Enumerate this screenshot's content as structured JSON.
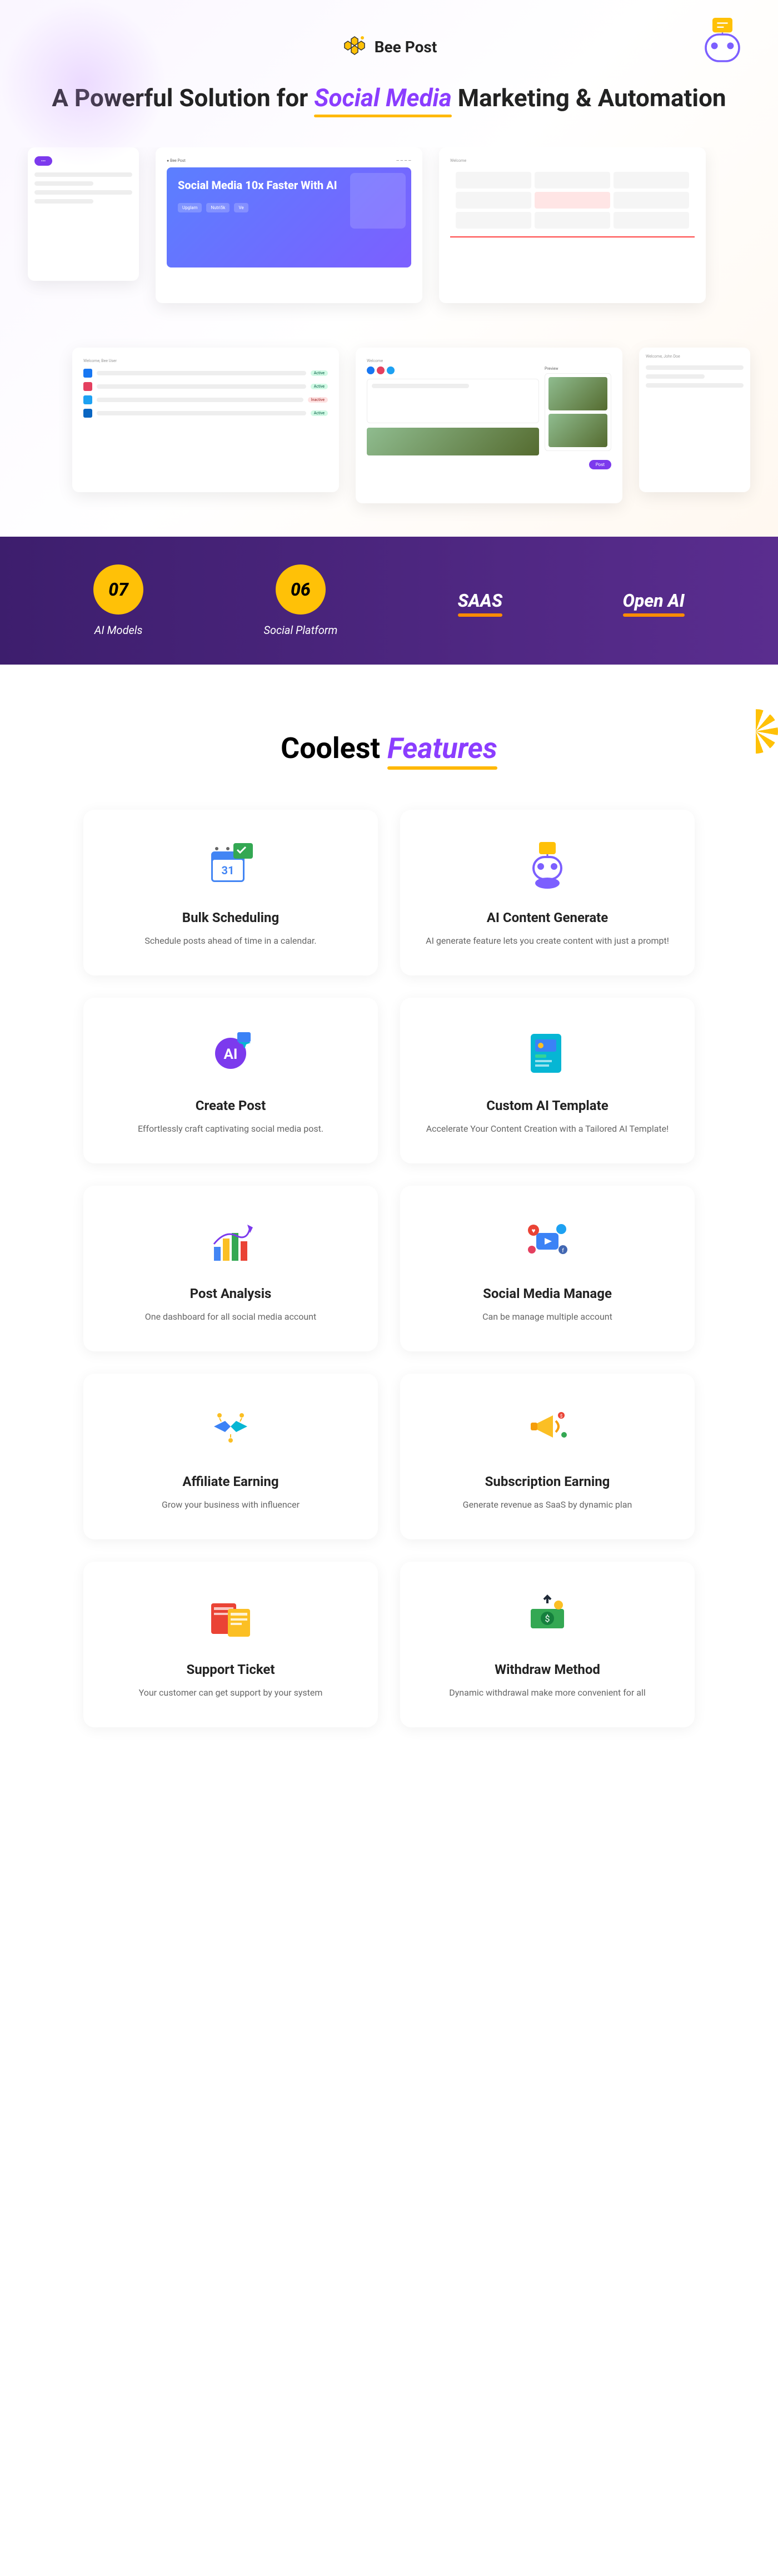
{
  "brand": "Bee Post",
  "hero": {
    "title_pre": "A Powerful Solution for ",
    "title_highlight": "Social Media",
    "title_post": " Marketing & Automation"
  },
  "screen_hero": {
    "headline": "Social Media 10x Faster With AI",
    "badges": [
      "Upglam",
      "Nutri5k",
      "Ve"
    ]
  },
  "stats": {
    "models_num": "07",
    "models_label": "AI Models",
    "platforms_num": "06",
    "platforms_label": "Social Platform",
    "saas": "SAAS",
    "openai": "Open AI"
  },
  "features_heading": {
    "pre": "Coolest ",
    "highlight": "Features"
  },
  "features": [
    {
      "name": "Bulk Scheduling",
      "desc": "Schedule posts ahead of time in a calendar.",
      "icon": "calendar-check"
    },
    {
      "name": "AI Content Generate",
      "desc": "AI generate feature lets you create content with just a prompt!",
      "icon": "bot"
    },
    {
      "name": "Create Post",
      "desc": "Effortlessly craft captivating social media post.",
      "icon": "ai-sparkle"
    },
    {
      "name": "Custom AI Template",
      "desc": "Accelerate Your Content Creation with a Tailored AI Template!",
      "icon": "template"
    },
    {
      "name": "Post Analysis",
      "desc": "One dashboard for all social media account",
      "icon": "chart"
    },
    {
      "name": "Social Media Manage",
      "desc": "Can be manage multiple account",
      "icon": "social"
    },
    {
      "name": "Affiliate Earning",
      "desc": "Grow your business with influencer",
      "icon": "handshake"
    },
    {
      "name": "Subscription Earning",
      "desc": "Generate revenue as SaaS by dynamic plan",
      "icon": "megaphone"
    },
    {
      "name": "Support Ticket",
      "desc": "Your customer can get support by your system",
      "icon": "ticket"
    },
    {
      "name": "Withdraw Method",
      "desc": "Dynamic withdrawal make more convenient for all",
      "icon": "money"
    }
  ]
}
